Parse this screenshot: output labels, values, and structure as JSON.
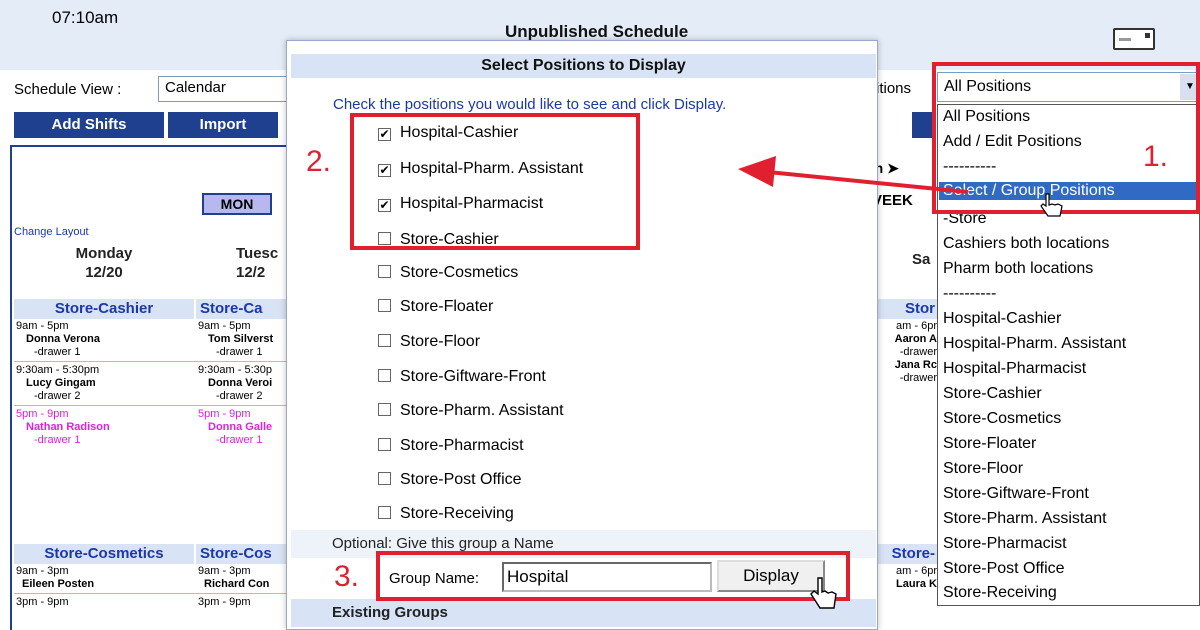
{
  "header": {
    "time": "07:10am",
    "title": "Unpublished Schedule"
  },
  "schedule_view": {
    "label": "Schedule View :",
    "value": "Calendar"
  },
  "positions_label": "itions",
  "nav_buttons": [
    "Add Shifts",
    "Import"
  ],
  "calendar": {
    "day_tab": "MON",
    "change_layout": "Change Layout",
    "days": [
      {
        "name": "Monday",
        "date": "12/20"
      },
      {
        "name": "Tuesc",
        "date": "12/2"
      }
    ],
    "right_day": "Sa",
    "week_nav": "th ➤",
    "week_label": "VEEK",
    "groups": [
      {
        "col1": "Store-Cashier",
        "col2": "Store-Ca",
        "col3": "Stor",
        "shifts": [
          {
            "time1": "9am - 5pm",
            "name1": "Donna Verona",
            "note1": "-drawer 1",
            "time2": "9am - 5pm",
            "name2": "Tom Silverst",
            "note2": "-drawer 1",
            "pink": false
          },
          {
            "time1": "9:30am - 5:30pm",
            "name1": "Lucy Gingam",
            "note1": "-drawer 2",
            "time2": "9:30am - 5:30p",
            "name2": "Donna Veroi",
            "note2": "-drawer 2",
            "pink": false
          },
          {
            "time1": "5pm - 9pm",
            "name1": "Nathan Radison",
            "note1": "-drawer 1",
            "time2": "5pm - 9pm",
            "name2": "Donna Galle",
            "note2": "-drawer 1",
            "pink": true
          }
        ],
        "col3_lines": [
          "am - 6pr",
          "Aaron A",
          "-drawer",
          "Jana Rc",
          "-drawer"
        ]
      },
      {
        "col1": "Store-Cosmetics",
        "col2": "Store-Cos",
        "col3": "Store-",
        "shifts": [
          {
            "time1": "9am - 3pm",
            "name1": "Eileen Posten",
            "note1": "",
            "time2": "9am - 3pm",
            "name2": "Richard Con",
            "note2": "",
            "pink": false
          }
        ],
        "col3_lines": [
          "am - 6pr",
          "Laura K"
        ],
        "last_time1": "3pm - 9pm",
        "last_time2": "3pm - 9pm"
      }
    ]
  },
  "dropdown": {
    "selected": "All Positions",
    "arrow": "▼",
    "options": [
      "All Positions",
      "Add / Edit Positions",
      "----------",
      "Select / Group Positions",
      "-Store",
      "Cashiers both locations",
      "Pharm both locations",
      "----------",
      "Hospital-Cashier",
      "Hospital-Pharm. Assistant",
      "Hospital-Pharmacist",
      "Store-Cashier",
      "Store-Cosmetics",
      "Store-Floater",
      "Store-Floor",
      "Store-Giftware-Front",
      "Store-Pharm. Assistant",
      "Store-Pharmacist",
      "Store-Post Office",
      "Store-Receiving"
    ],
    "highlighted_index": 3
  },
  "modal": {
    "title": "Select Positions to Display",
    "instruction": "Check the positions you would like to see and click Display.",
    "positions": [
      {
        "label": "Hospital-Cashier",
        "checked": true
      },
      {
        "label": "Hospital-Pharm. Assistant",
        "checked": true
      },
      {
        "label": "Hospital-Pharmacist",
        "checked": true
      },
      {
        "label": "Store-Cashier",
        "checked": false
      },
      {
        "label": "Store-Cosmetics",
        "checked": false
      },
      {
        "label": "Store-Floater",
        "checked": false
      },
      {
        "label": "Store-Floor",
        "checked": false
      },
      {
        "label": "Store-Giftware-Front",
        "checked": false
      },
      {
        "label": "Store-Pharm. Assistant",
        "checked": false
      },
      {
        "label": "Store-Pharmacist",
        "checked": false
      },
      {
        "label": "Store-Post Office",
        "checked": false
      },
      {
        "label": "Store-Receiving",
        "checked": false
      }
    ],
    "optional_label": "Optional: Give this group a Name",
    "group_name_label": "Group Name:",
    "group_name_value": "Hospital",
    "display_button": "Display",
    "existing_groups": "Existing Groups"
  },
  "annotations": {
    "step1": "1.",
    "step2": "2.",
    "step3": "3.",
    "color": "#e02030"
  },
  "colors": {
    "nav_button": "#1f3f8f",
    "group_header_text": "#1c38a8",
    "dropdown_highlight": "#316ac5",
    "pink_shift": "#e020e0"
  }
}
